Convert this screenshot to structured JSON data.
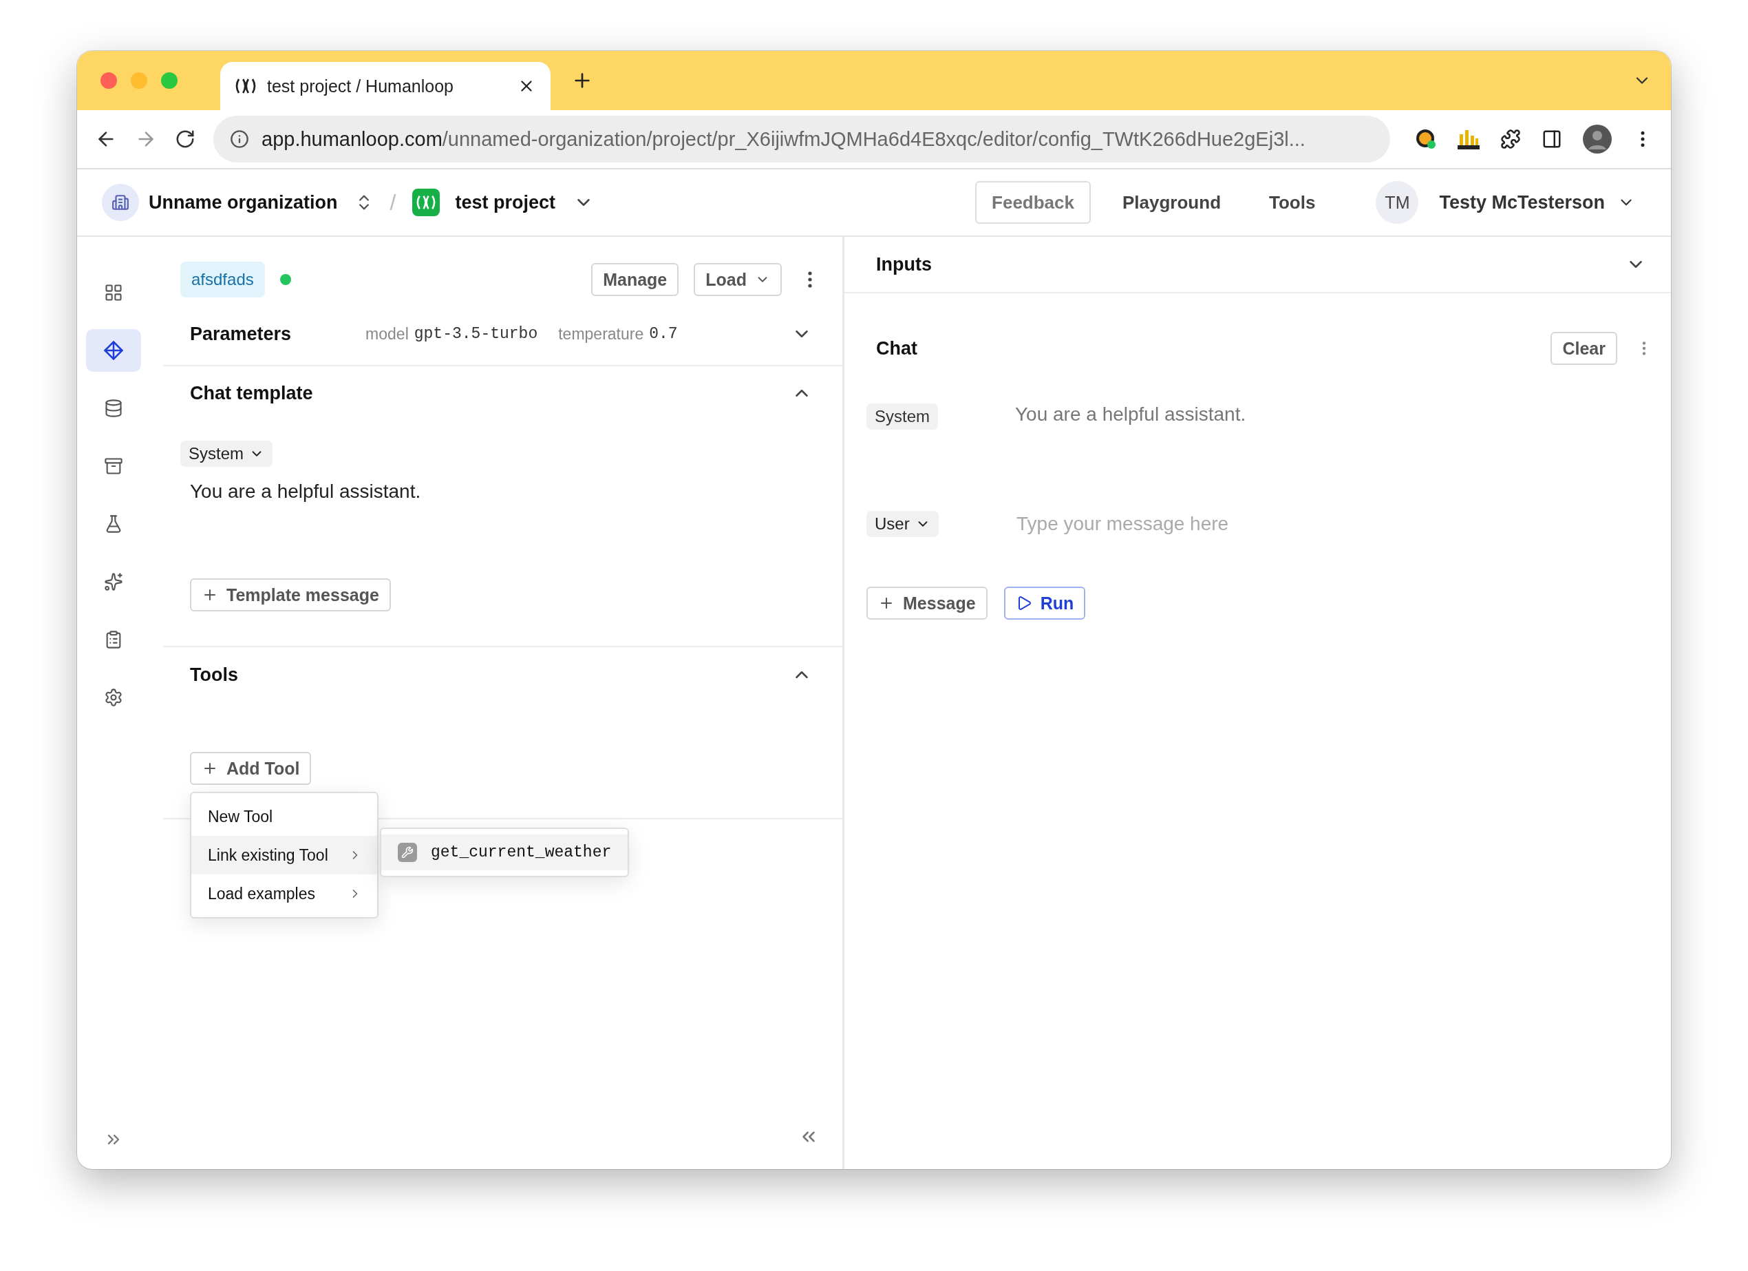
{
  "browser": {
    "tab_title": "test project / Humanloop",
    "url_host": "app.humanloop.com",
    "url_path": "/unnamed-organization/project/pr_X6ijiwfmJQMHa6d4E8xqc/editor/config_TWtK266dHue2gEj3l..."
  },
  "header": {
    "organization": "Unname organization",
    "separator": "/",
    "project": "test project",
    "nav": [
      {
        "label": "Feedback",
        "selected": true
      },
      {
        "label": "Playground",
        "selected": false
      },
      {
        "label": "Tools",
        "selected": false
      }
    ],
    "user_initials": "TM",
    "user_name": "Testy McTesterson"
  },
  "sidebar": {
    "items": [
      {
        "kind": "grid",
        "selected": false
      },
      {
        "kind": "editor",
        "selected": true
      },
      {
        "kind": "database",
        "selected": false
      },
      {
        "kind": "archive",
        "selected": false
      },
      {
        "kind": "flask",
        "selected": false
      },
      {
        "kind": "sparkles",
        "selected": false
      },
      {
        "kind": "clipboard",
        "selected": false
      },
      {
        "kind": "settings",
        "selected": false
      }
    ]
  },
  "config": {
    "version_label": "afsdfads",
    "deployed": true,
    "buttons": [
      {
        "label": "Manage",
        "dropdown": false
      },
      {
        "label": "Load",
        "dropdown": true
      }
    ]
  },
  "parameters": {
    "title": "Parameters",
    "model_label": "model",
    "model": "gpt-3.5-turbo",
    "temperature_label": "temperature",
    "temperature": "0.7",
    "expanded": false
  },
  "chat_template": {
    "title": "Chat template",
    "expanded": true,
    "messages": [
      {
        "role": "System",
        "content": "You are a helpful assistant."
      }
    ],
    "add_button": "Template message"
  },
  "tools": {
    "title": "Tools",
    "expanded": true,
    "add_button": "Add Tool",
    "menu": [
      {
        "label": "New Tool",
        "submenu": false,
        "selected": false
      },
      {
        "label": "Link existing Tool",
        "submenu": true,
        "selected": true
      },
      {
        "label": "Load examples",
        "submenu": true,
        "selected": false
      }
    ],
    "submenu": [
      {
        "label": "get_current_weather",
        "selected": true
      }
    ]
  },
  "inputs": {
    "title": "Inputs",
    "expanded": false
  },
  "chat": {
    "title": "Chat",
    "clear_button": "Clear",
    "messages": [
      {
        "role": "System",
        "role_dropdown": false,
        "content": "You are a helpful assistant."
      },
      {
        "role": "User",
        "role_dropdown": true,
        "placeholder": "Type your message here"
      }
    ],
    "add_button": "Message",
    "run_button": "Run"
  }
}
